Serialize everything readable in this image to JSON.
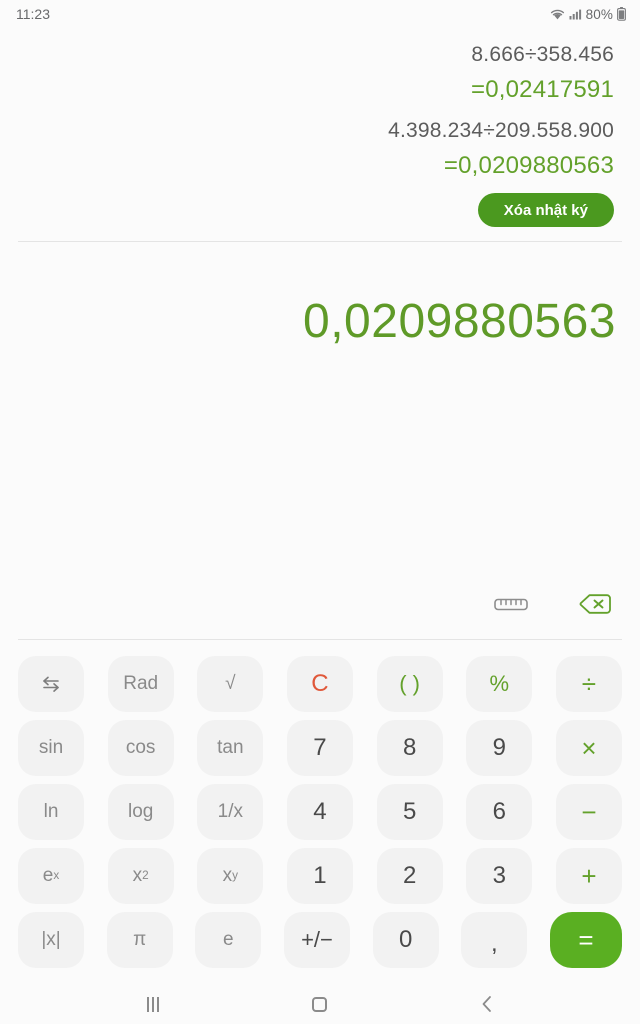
{
  "statusbar": {
    "time": "11:23",
    "battery_percent": "80%",
    "wifi_icon": "wifi-icon",
    "signal_icon": "cellular-signal-icon",
    "battery_icon": "battery-icon"
  },
  "history": {
    "entries": [
      {
        "expression": "8.666÷358.456",
        "result": "=0,02417591"
      },
      {
        "expression": "4.398.234÷209.558.900",
        "result": "=0,0209880563"
      }
    ],
    "clear_label": "Xóa nhật ký"
  },
  "display": {
    "result": "0,0209880563",
    "unit_converter_icon": "ruler-icon",
    "backspace_icon": "backspace-icon"
  },
  "keypad": {
    "rows": [
      [
        {
          "label": "⇆",
          "name": "swap-icon-key",
          "style": "fn"
        },
        {
          "label": "Rad",
          "name": "rad-key",
          "style": "fn"
        },
        {
          "label": "√",
          "name": "sqrt-key",
          "style": "fn"
        },
        {
          "label": "C",
          "name": "clear-key",
          "style": "clear"
        },
        {
          "label": "( )",
          "name": "parentheses-key",
          "style": "op"
        },
        {
          "label": "%",
          "name": "percent-key",
          "style": "op"
        },
        {
          "label": "÷",
          "name": "divide-key",
          "style": "op"
        }
      ],
      [
        {
          "label": "sin",
          "name": "sin-key",
          "style": "fn"
        },
        {
          "label": "cos",
          "name": "cos-key",
          "style": "fn"
        },
        {
          "label": "tan",
          "name": "tan-key",
          "style": "fn"
        },
        {
          "label": "7",
          "name": "seven-key",
          "style": "num"
        },
        {
          "label": "8",
          "name": "eight-key",
          "style": "num"
        },
        {
          "label": "9",
          "name": "nine-key",
          "style": "num"
        },
        {
          "label": "×",
          "name": "multiply-key",
          "style": "op"
        }
      ],
      [
        {
          "label": "ln",
          "name": "ln-key",
          "style": "fn"
        },
        {
          "label": "log",
          "name": "log-key",
          "style": "fn"
        },
        {
          "label": "1/x",
          "name": "reciprocal-key",
          "style": "fn"
        },
        {
          "label": "4",
          "name": "four-key",
          "style": "num"
        },
        {
          "label": "5",
          "name": "five-key",
          "style": "num"
        },
        {
          "label": "6",
          "name": "six-key",
          "style": "num"
        },
        {
          "label": "−",
          "name": "minus-key",
          "style": "op"
        }
      ],
      [
        {
          "label": "e^x",
          "name": "exp-key",
          "style": "fn",
          "base": "e",
          "sup": "x"
        },
        {
          "label": "x^2",
          "name": "square-key",
          "style": "fn",
          "base": "x",
          "sup": "2"
        },
        {
          "label": "x^y",
          "name": "power-key",
          "style": "fn",
          "base": "x",
          "sup": "y"
        },
        {
          "label": "1",
          "name": "one-key",
          "style": "num"
        },
        {
          "label": "2",
          "name": "two-key",
          "style": "num"
        },
        {
          "label": "3",
          "name": "three-key",
          "style": "num"
        },
        {
          "label": "+",
          "name": "plus-key",
          "style": "op"
        }
      ],
      [
        {
          "label": "|x|",
          "name": "absolute-key",
          "style": "fn"
        },
        {
          "label": "π",
          "name": "pi-key",
          "style": "fn"
        },
        {
          "label": "e",
          "name": "euler-key",
          "style": "fn"
        },
        {
          "label": "+/−",
          "name": "sign-toggle-key",
          "style": "num"
        },
        {
          "label": "0",
          "name": "zero-key",
          "style": "num"
        },
        {
          "label": ",",
          "name": "decimal-comma-key",
          "style": "num"
        },
        {
          "label": "=",
          "name": "equals-key",
          "style": "equals"
        }
      ]
    ]
  },
  "navbar": {
    "recents_label": "recents-icon",
    "home_label": "home-icon",
    "back_label": "back-icon"
  },
  "colors": {
    "accent_green": "#63a12b",
    "equals_green": "#5aaf22",
    "clear_button_green": "#4b991f",
    "clear_key_orange": "#e0583a",
    "background": "#fbfbfb",
    "key_background": "#f2f2f2"
  }
}
